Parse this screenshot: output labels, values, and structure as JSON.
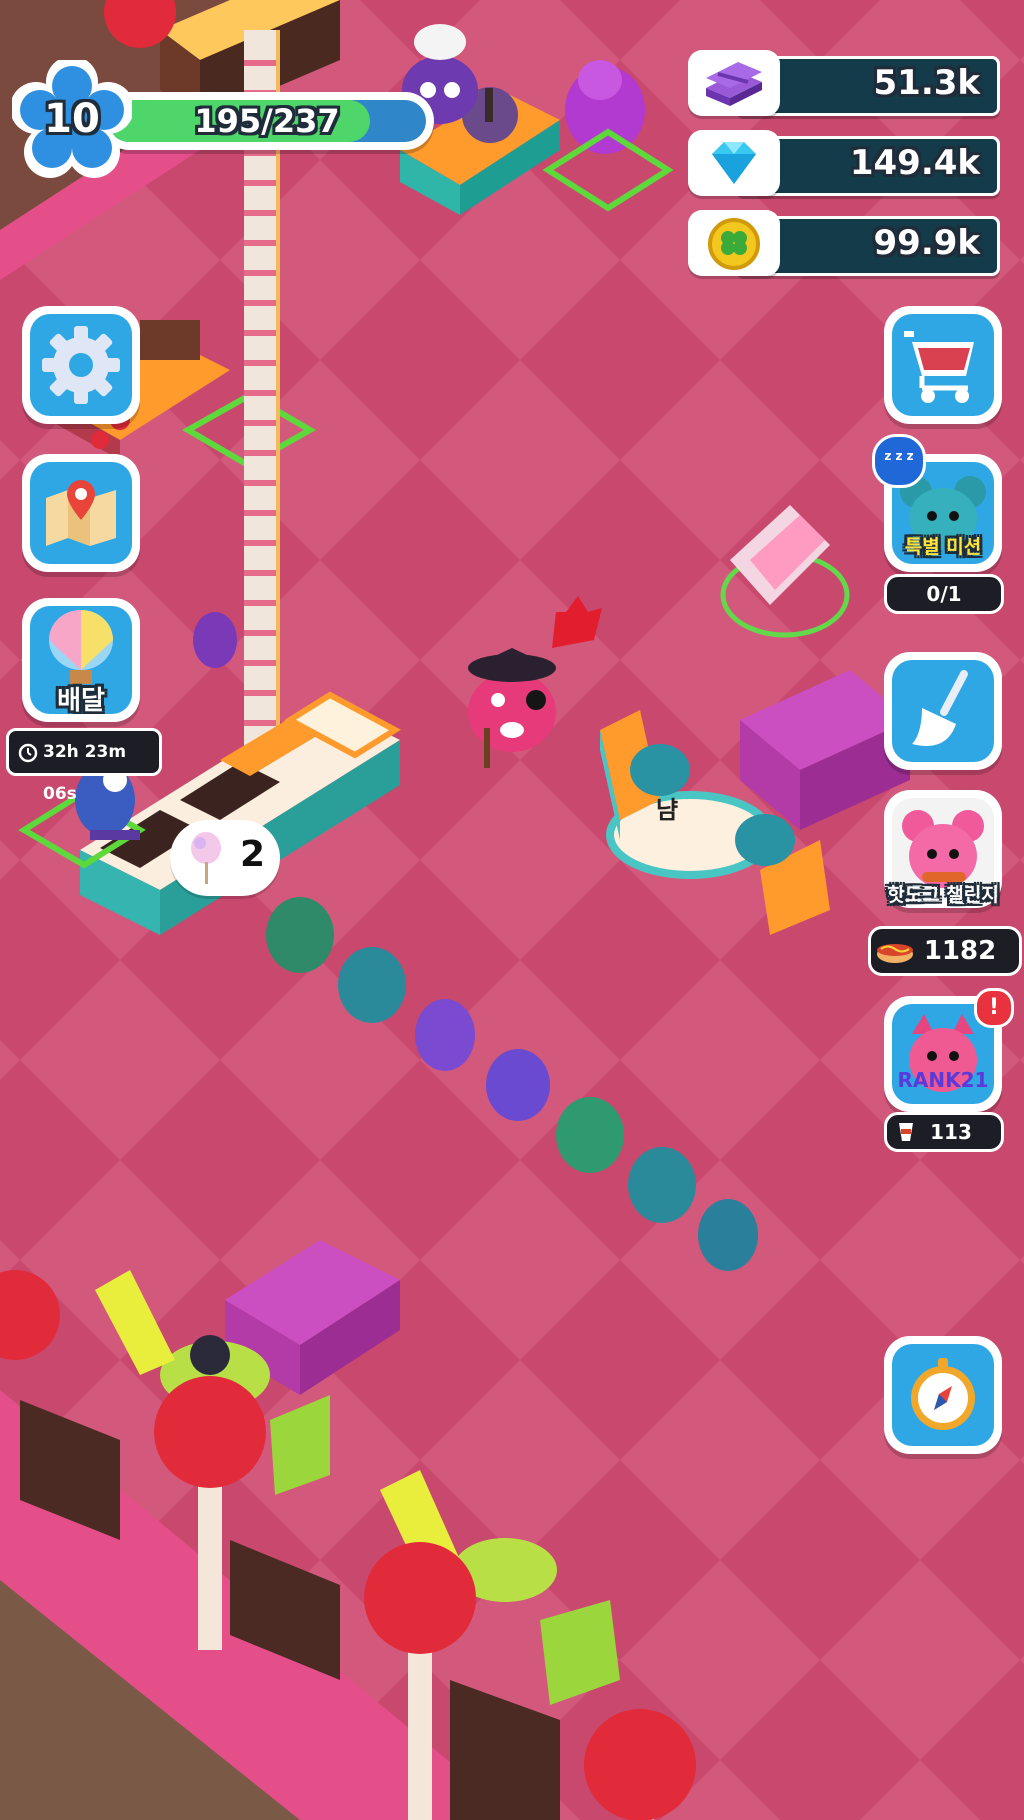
{
  "hud": {
    "level": "10",
    "xp_text": "195/237",
    "xp_fraction": 0.823
  },
  "currencies": {
    "cash": "51.3k",
    "gems": "149.4k",
    "clover": "99.9k"
  },
  "left_buttons": {
    "settings": "settings",
    "map": "map",
    "delivery_label": "배달",
    "delivery_timer": "32h 23m 06s"
  },
  "right_buttons": {
    "special_mission_label": "특별 미션",
    "special_mission_progress": "0/1",
    "sleep_badge": "z z z",
    "hotdog_challenge_label": "핫도그 챌린지",
    "hotdog_count": "1182",
    "rank_label": "RANK21",
    "rank_count": "113",
    "alert_badge": "!"
  },
  "world": {
    "order_bubble_count": "2",
    "seat_tag": "냠"
  },
  "colors": {
    "floor_dark": "#c2446a",
    "floor_light": "#d0567a",
    "button_blue": "#2fa7e4",
    "xp_green": "#4fd66a",
    "hud_dark": "#143b4a"
  }
}
